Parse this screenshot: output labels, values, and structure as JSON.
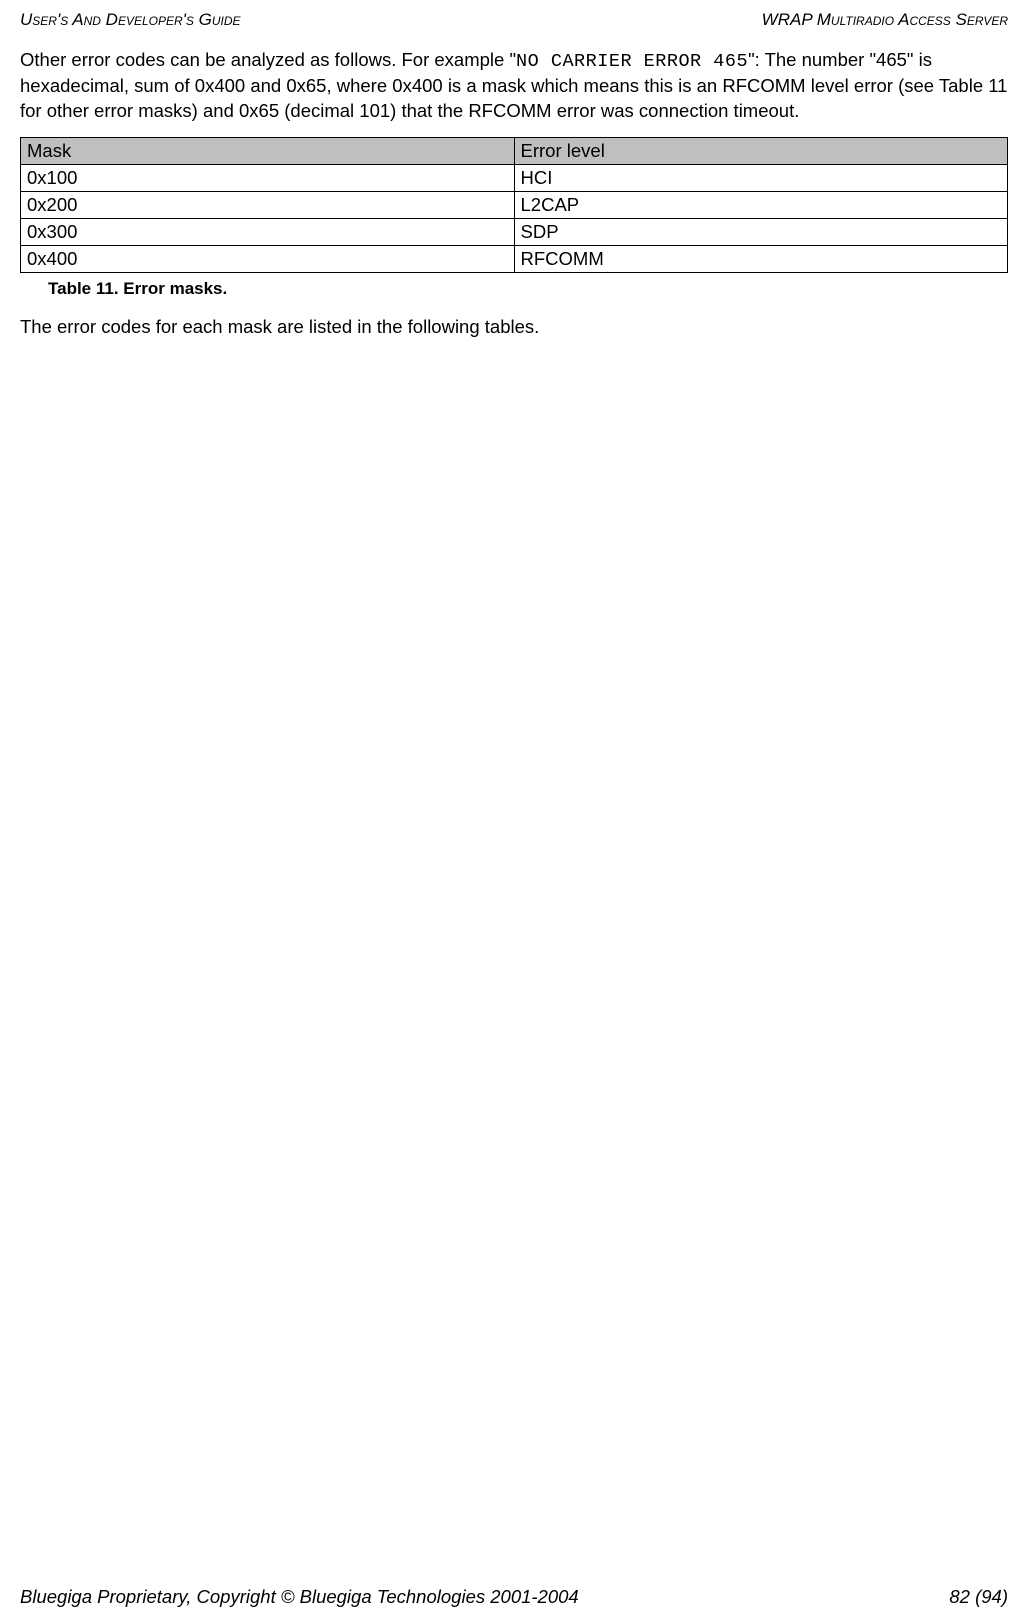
{
  "header": {
    "left": "User's And Developer's Guide",
    "right": "WRAP Multiradio Access Server"
  },
  "para1": {
    "beforeCode": "Other error codes can be analyzed as follows. For example \"",
    "code": "NO CARRIER ERROR 465",
    "afterCode": "\": The number \"465\" is hexadecimal, sum of 0x400 and 0x65, where 0x400 is a mask which means this is an RFCOMM level error (see Table 11 for other error masks) and 0x65 (decimal 101) that the RFCOMM error was connection timeout."
  },
  "table": {
    "headers": [
      "Mask",
      "Error level"
    ],
    "rows": [
      [
        "0x100",
        "HCI"
      ],
      [
        "0x200",
        "L2CAP"
      ],
      [
        "0x300",
        "SDP"
      ],
      [
        "0x400",
        "RFCOMM"
      ]
    ],
    "caption": "Table 11. Error masks."
  },
  "para2": "The error codes for each mask are listed in the following tables.",
  "footer": {
    "left": "Bluegiga Proprietary, Copyright © Bluegiga Technologies 2001-2004",
    "right": "82 (94)"
  }
}
